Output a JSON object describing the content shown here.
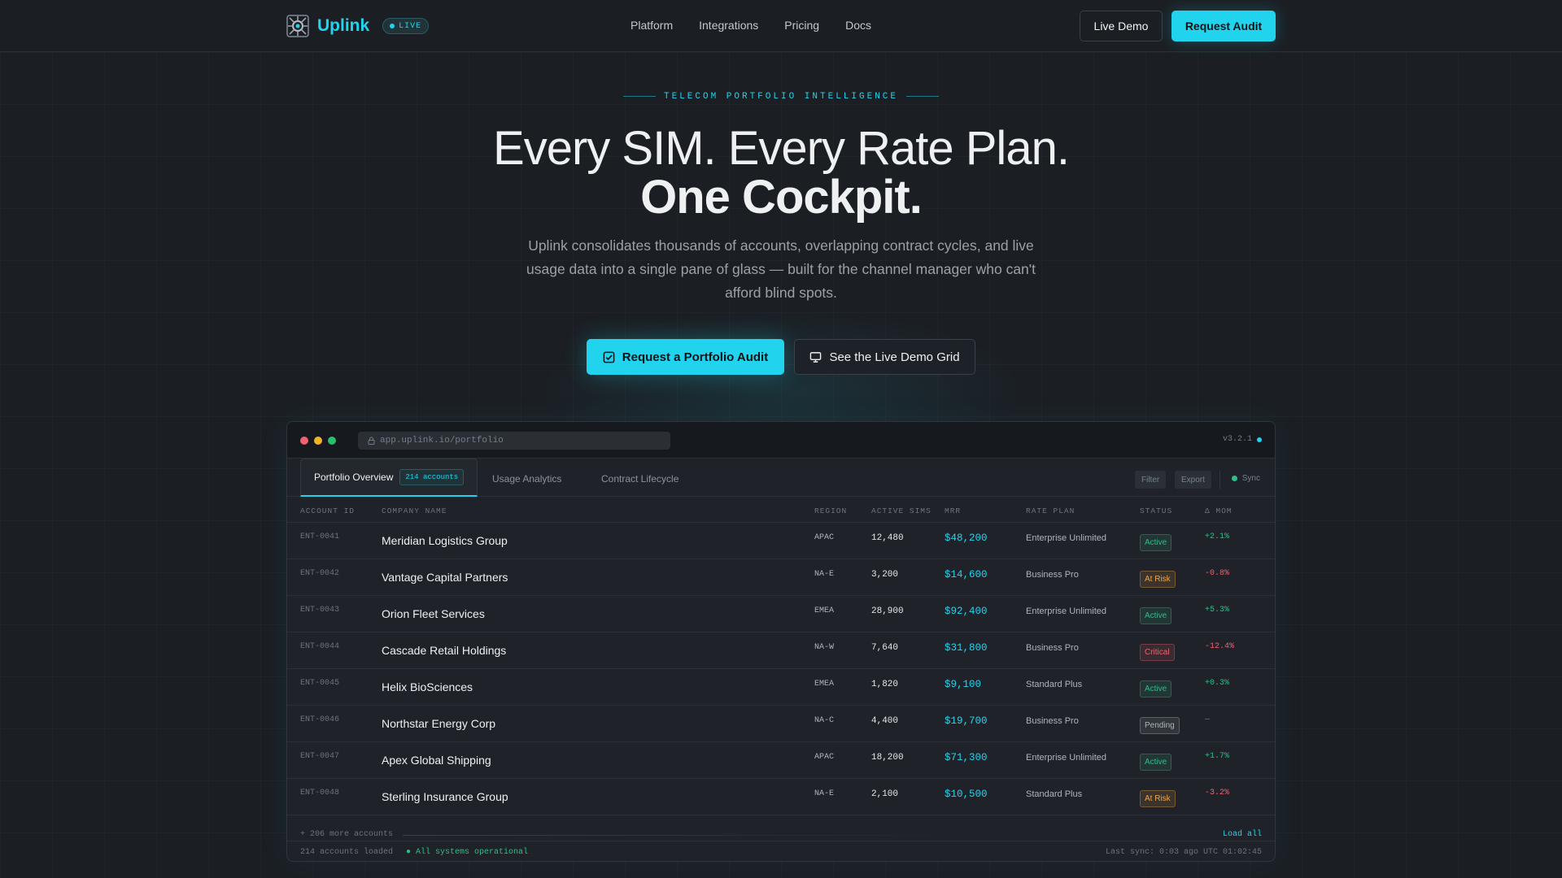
{
  "nav": {
    "brand": "Uplink",
    "live_badge": "LIVE",
    "links": [
      "Platform",
      "Integrations",
      "Pricing",
      "Docs"
    ],
    "live_demo": "Live Demo",
    "request_audit": "Request Audit"
  },
  "hero": {
    "eyebrow": "TELECOM PORTFOLIO INTELLIGENCE",
    "headline_line1": "Every SIM. Every Rate Plan.",
    "headline_line2": "One Cockpit.",
    "subcopy": "Uplink consolidates thousands of accounts, overlapping contract cycles, and live usage data into a single pane of glass — built for the channel manager who can't afford blind spots.",
    "cta_primary": "Request a Portfolio Audit",
    "cta_secondary": "See the Live Demo Grid"
  },
  "app": {
    "url": "app.uplink.io/portfolio",
    "version": "v3.2.1",
    "tabs": {
      "active_label": "Portfolio Overview",
      "active_count": "214 accounts",
      "usage": "Usage Analytics",
      "contract": "Contract Lifecycle"
    },
    "toolbar": {
      "filter": "Filter",
      "export": "Export",
      "sync": "Sync"
    },
    "columns": [
      "ACCOUNT ID",
      "COMPANY NAME",
      "REGION",
      "ACTIVE SIMS",
      "MRR",
      "RATE PLAN",
      "STATUS",
      "Δ MOM"
    ],
    "rows": [
      {
        "id": "ENT-0041",
        "name": "Meridian Logistics Group",
        "region": "APAC",
        "sims": "12,480",
        "mrr": "$48,200",
        "plan": "Enterprise Unlimited",
        "status": "Active",
        "mom": "+2.1%"
      },
      {
        "id": "ENT-0042",
        "name": "Vantage Capital Partners",
        "region": "NA-E",
        "sims": "3,200",
        "mrr": "$14,600",
        "plan": "Business Pro",
        "status": "At Risk",
        "mom": "-0.8%"
      },
      {
        "id": "ENT-0043",
        "name": "Orion Fleet Services",
        "region": "EMEA",
        "sims": "28,900",
        "mrr": "$92,400",
        "plan": "Enterprise Unlimited",
        "status": "Active",
        "mom": "+5.3%"
      },
      {
        "id": "ENT-0044",
        "name": "Cascade Retail Holdings",
        "region": "NA-W",
        "sims": "7,640",
        "mrr": "$31,800",
        "plan": "Business Pro",
        "status": "Critical",
        "mom": "-12.4%"
      },
      {
        "id": "ENT-0045",
        "name": "Helix BioSciences",
        "region": "EMEA",
        "sims": "1,820",
        "mrr": "$9,100",
        "plan": "Standard Plus",
        "status": "Active",
        "mom": "+0.3%"
      },
      {
        "id": "ENT-0046",
        "name": "Northstar Energy Corp",
        "region": "NA-C",
        "sims": "4,400",
        "mrr": "$19,700",
        "plan": "Business Pro",
        "status": "Pending",
        "mom": "—"
      },
      {
        "id": "ENT-0047",
        "name": "Apex Global Shipping",
        "region": "APAC",
        "sims": "18,200",
        "mrr": "$71,300",
        "plan": "Enterprise Unlimited",
        "status": "Active",
        "mom": "+1.7%"
      },
      {
        "id": "ENT-0048",
        "name": "Sterling Insurance Group",
        "region": "NA-E",
        "sims": "2,100",
        "mrr": "$10,500",
        "plan": "Standard Plus",
        "status": "At Risk",
        "mom": "-3.2%"
      }
    ],
    "more_accounts": "+ 206 more accounts",
    "load_all": "Load all",
    "status_loaded": "214 accounts loaded",
    "status_ok": "● All systems operational",
    "status_right": "Last sync: 0:03 ago   UTC 01:02:45"
  },
  "colors": {
    "accent": "#22d3ee",
    "active": "#2bbf8a",
    "at_risk": "#f0a44b",
    "critical": "#f0626e",
    "pending": "#aeb4ba"
  }
}
